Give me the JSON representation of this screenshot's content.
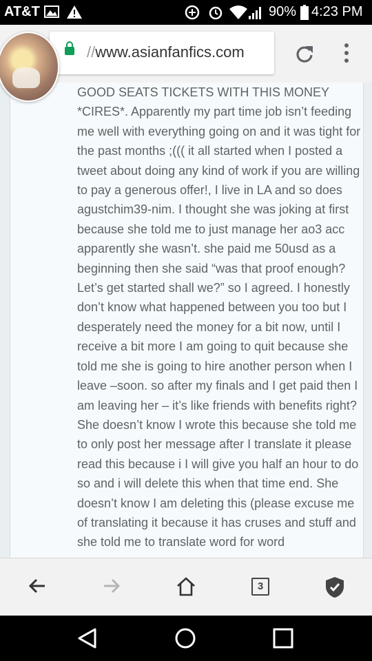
{
  "status_bar": {
    "carrier": "AT&T",
    "battery_percent": "90%",
    "time": "4:23 PM",
    "icons": [
      "image-icon",
      "warning-icon",
      "data-saver-icon",
      "alarm-icon",
      "wifi-icon",
      "signal-icon",
      "battery-icon"
    ]
  },
  "browser": {
    "url_scheme": "//",
    "url_domain": "www.asianfanfics.com",
    "secure_color": "#0f9d58",
    "icons": [
      "lock-icon",
      "reload-icon",
      "menu-dots-icon"
    ]
  },
  "story": {
    "text": "GOOD SEATS TICKETS WITH THIS MONEY *CIRES*. Apparently my part time job isn’t feeding me well with everything going on and it was tight for the past months ;((( it all started when I posted a tweet about doing any kind of work if you are willing to pay a generous offer!, I live in LA and so does agustchim39-nim. I thought she was joking at first because she told me to just manage her ao3 acc apparently she wasn’t. she paid me 50usd as a beginning then she said “was that proof enough? Let’s get started shall we?” so I agreed. I honestly don’t know what happened between you too but I desperately need the money for a bit now, until I receive a bit more I am going to quit because she told me she is going to hire another person when I leave –soon. so after my finals and I get paid then I am leaving her – it’s like friends with benefits right? She doesn’t know I wrote this because she told me to only post her message after I translate it please read this because i I will give you half an hour to do so and i will delete this when that time end. She doesn’t know I am deleting this (please excuse me of translating it because it has cruses and stuff and she told me to translate word for word"
  },
  "bottom_nav": {
    "tab_count": "3",
    "icons": [
      "back-arrow-icon",
      "forward-arrow-icon",
      "home-icon",
      "tabs-icon",
      "shield-check-icon"
    ]
  },
  "system_nav": {
    "icons": [
      "back-triangle-icon",
      "home-circle-icon",
      "recents-square-icon"
    ]
  }
}
